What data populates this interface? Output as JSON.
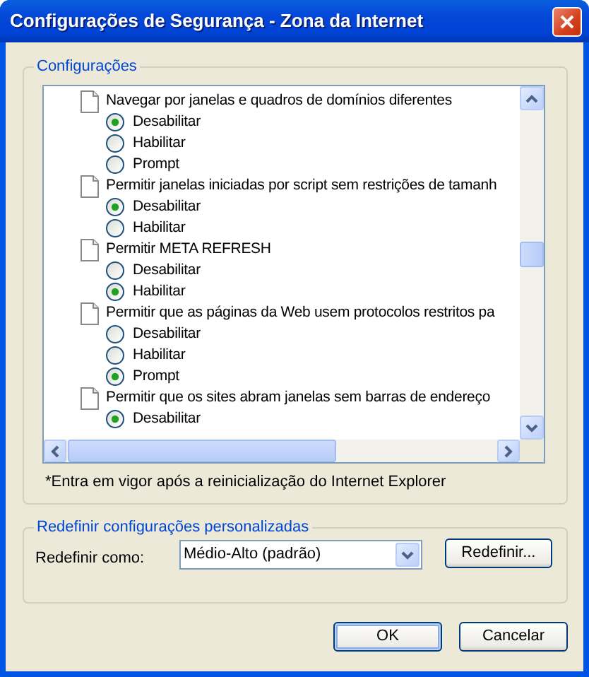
{
  "window": {
    "title": "Configurações de Segurança - Zona da Internet"
  },
  "settings_group": {
    "legend": "Configurações",
    "items": [
      {
        "label": "Navegar por janelas e quadros de domínios diferentes",
        "options": [
          {
            "label": "Desabilitar",
            "selected": true
          },
          {
            "label": "Habilitar",
            "selected": false
          },
          {
            "label": "Prompt",
            "selected": false
          }
        ]
      },
      {
        "label": "Permitir janelas iniciadas por script sem restrições de tamanh",
        "options": [
          {
            "label": "Desabilitar",
            "selected": true
          },
          {
            "label": "Habilitar",
            "selected": false
          }
        ]
      },
      {
        "label": "Permitir META REFRESH",
        "options": [
          {
            "label": "Desabilitar",
            "selected": false
          },
          {
            "label": "Habilitar",
            "selected": true
          }
        ]
      },
      {
        "label": "Permitir que as páginas da Web usem protocolos restritos pa",
        "options": [
          {
            "label": "Desabilitar",
            "selected": false
          },
          {
            "label": "Habilitar",
            "selected": false
          },
          {
            "label": "Prompt",
            "selected": true
          }
        ]
      },
      {
        "label": "Permitir que os sites abram janelas sem barras de endereço",
        "options": [
          {
            "label": "Desabilitar",
            "selected": true
          }
        ]
      }
    ],
    "note": "*Entra em vigor após a reinicialização do Internet Explorer"
  },
  "reset_group": {
    "legend": "Redefinir configurações personalizadas",
    "label": "Redefinir como:",
    "dropdown": {
      "value": "Médio-Alto (padrão)"
    },
    "button": "Redefinir..."
  },
  "buttons": [
    {
      "label": "OK",
      "default": true
    },
    {
      "label": "Cancelar",
      "default": false
    }
  ]
}
